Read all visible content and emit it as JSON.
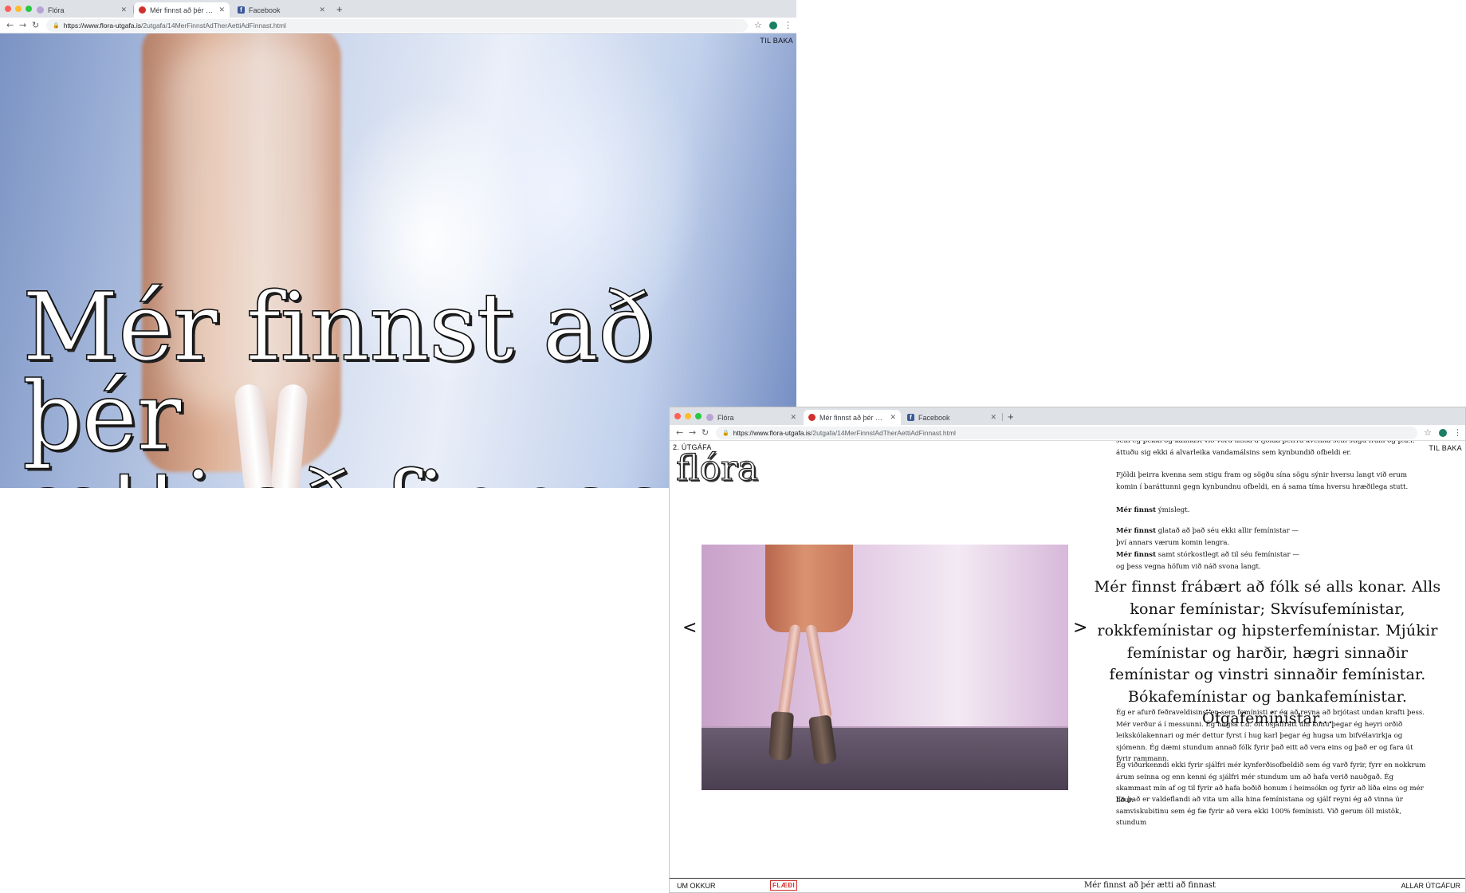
{
  "window1": {
    "tabs": [
      {
        "label": "Flóra",
        "favicon_color": "#b9a3d6"
      },
      {
        "label": "Mér finnst að þér ætti að finna...",
        "favicon_color": "#d0312d"
      },
      {
        "label": "Facebook",
        "favicon_color": "#3b5998"
      }
    ],
    "url_host": "https://www.flora-utgafa.is",
    "url_path": "/2utgafa/14MerFinnstAdTherAettiAdFinnast.html",
    "back_label": "TIL BAKA",
    "hero_title": "Mér finnst að þér\nætti að finnast"
  },
  "window2": {
    "tabs": [
      {
        "label": "Flóra",
        "favicon_color": "#b9a3d6"
      },
      {
        "label": "Mér finnst að þér ætti að finna...",
        "favicon_color": "#d0312d"
      },
      {
        "label": "Facebook",
        "favicon_color": "#3b5998"
      }
    ],
    "url_host": "https://www.flora-utgafa.is",
    "url_path": "/2utgafa/14MerFinnstAdTherAettiAdFinnast.html",
    "issue_label": "2. ÚTGÁFA",
    "logo": "flóra",
    "back_label": "TIL BAKA",
    "prev_arrow": "<",
    "next_arrow": ">",
    "para1": "sem ég þekki og kannast við voru hissa á fjölda þeirra kvenna sem stigu fram og þ.a.l. áttuðu sig ekki á alvarleika vandamálsins sem kynbundið ofbeldi er.",
    "para2": "Fjöldi þeirra kvenna sem stigu fram og sögðu sína sögu sýnir hversu langt við erum komin í baráttunni gegn kynbundnu ofbeldi, en á sama tíma hversu hræðilega stutt.",
    "para3_bold": "Mér finnst",
    "para3_rest": " ýmislegt.",
    "para4_bold": "Mér finnst",
    "para4_line1": " glatað að það séu ekki allir femínistar —",
    "para4_line2": "því annars værum komin lengra.",
    "para5_bold": "Mér finnst",
    "para5_line1": " samt stórkostlegt að til séu femínistar —",
    "para5_line2": "og þess vegna höfum við náð svona langt.",
    "quote": "Mér finnst frábært að fólk sé alls konar. Alls konar femínistar;  Skvísufemínistar, rokkfemínistar og hipsterfemínistar. Mjúkir femínistar og harðir, hægri sinnaðir femínistar og vinstri sinnaðir femínistar. Bókafemínistar og bankafemínistar. Öfgafemínistar...",
    "para6": "Ég er afurð feðraveldisins, en sem femínisti er ég að reyna að brjótast undan krafti þess. Mér verður á í messunni. Ég hugsa t.d. oft ósjálfrátt um konu þegar ég heyri orðið leikskólakennari og mér dettur fyrst í hug karl þegar ég hugsa um bifvélavirkja og sjómenn. Ég dæmi stundum annað fólk fyrir það eitt að vera eins og það er og fara út fyrir rammann.",
    "para7": "Ég viðurkenndi ekki fyrir sjálfri mér kynferðisofbeldið sem ég varð fyrir, fyrr en nokkrum árum seinna og enn kenni ég sjálfri mér stundum um að hafa verið nauðgað. Ég skammast mín af og til fyrir að hafa boðið honum í heimsókn og fyrir að líða eins og mér líður.",
    "para8": "En það er valdeflandi að vita um alla hina femínistana og sjálf reyni ég að vinna úr samviskubitinu sem ég fæ fyrir að vera ekki 100% femínisti. Við gerum öll mistök, stundum",
    "bottom": {
      "about": "UM OKKUR",
      "flaedi": "FLÆÐI",
      "article_title": "Mér finnst að þér ætti að finnast",
      "all_issues": "ALLAR ÚTGÁFUR"
    }
  },
  "colors": {
    "accent_red": "#d0312d",
    "tab_bar": "#dee1e6",
    "traffic_red": "#ff5f57",
    "traffic_yellow": "#febc2e",
    "traffic_green": "#28c840"
  }
}
